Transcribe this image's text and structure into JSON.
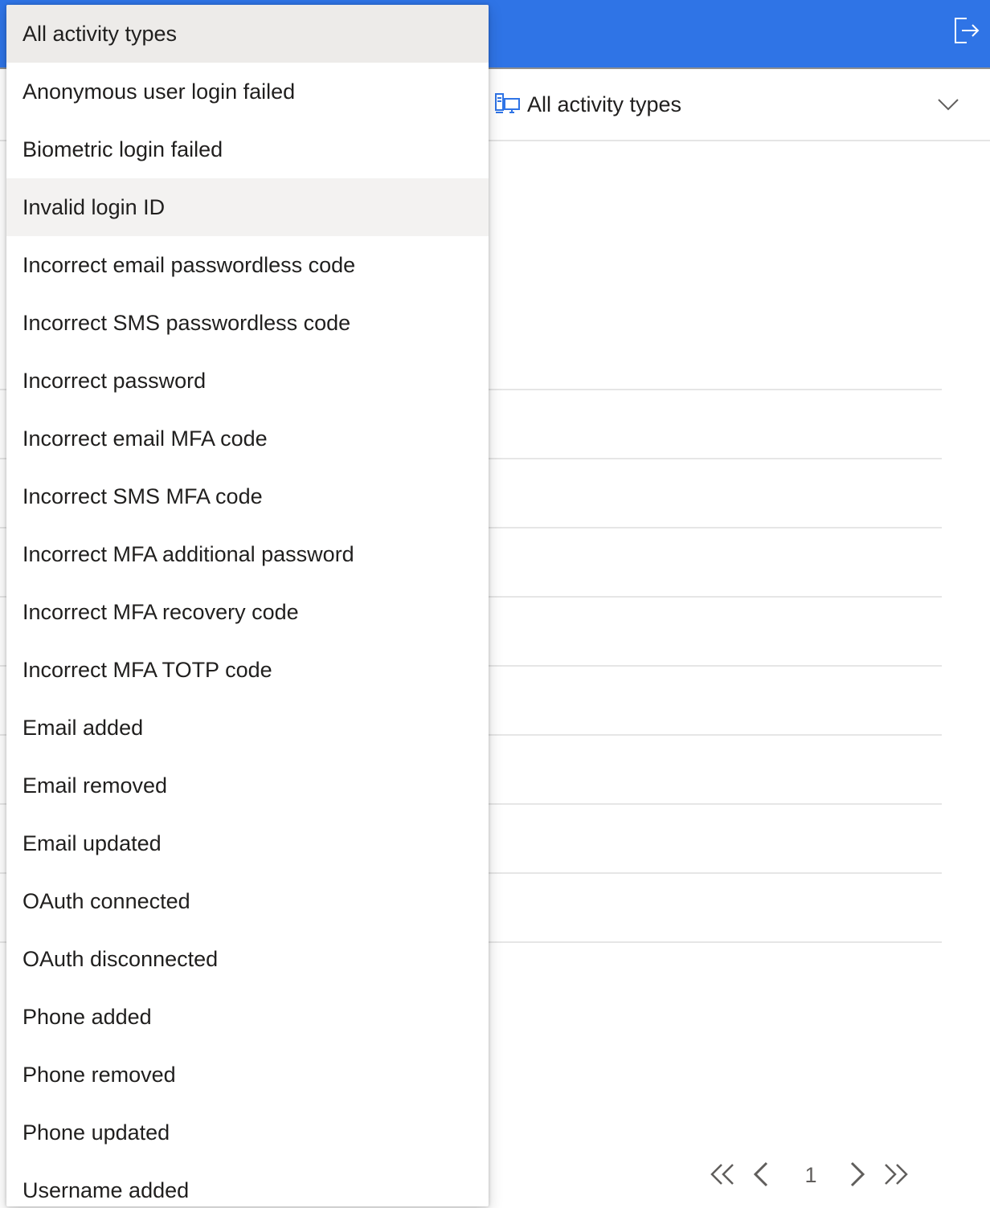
{
  "filter": {
    "icon": "activity-filter-icon",
    "selected_label": "All activity types"
  },
  "pager": {
    "current_page": "1"
  },
  "dropdown": {
    "selected_index": 0,
    "hovered_index": 3,
    "items": [
      {
        "label": "All activity types"
      },
      {
        "label": "Anonymous user login failed"
      },
      {
        "label": "Biometric login failed"
      },
      {
        "label": "Invalid login ID"
      },
      {
        "label": "Incorrect email passwordless code"
      },
      {
        "label": "Incorrect SMS passwordless code"
      },
      {
        "label": "Incorrect password"
      },
      {
        "label": "Incorrect email MFA code"
      },
      {
        "label": "Incorrect SMS MFA code"
      },
      {
        "label": "Incorrect MFA additional password"
      },
      {
        "label": "Incorrect MFA recovery code"
      },
      {
        "label": "Incorrect MFA TOTP code"
      },
      {
        "label": "Email added"
      },
      {
        "label": "Email removed"
      },
      {
        "label": "Email updated"
      },
      {
        "label": "OAuth connected"
      },
      {
        "label": "OAuth disconnected"
      },
      {
        "label": "Phone added"
      },
      {
        "label": "Phone removed"
      },
      {
        "label": "Phone updated"
      },
      {
        "label": "Username added"
      }
    ]
  },
  "colors": {
    "header_bg": "#2f74e6",
    "selected_item_bg": "#edebe9",
    "hovered_item_bg": "#f3f2f1"
  }
}
